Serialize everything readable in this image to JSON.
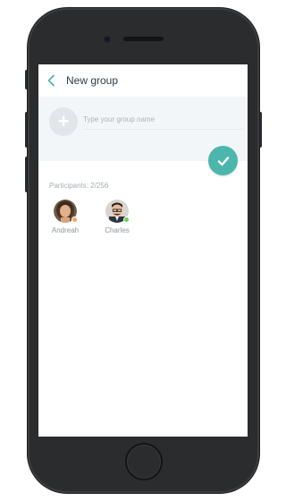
{
  "header": {
    "title": "New group"
  },
  "group_form": {
    "name_placeholder": "Type your group name"
  },
  "participants": {
    "label": "Participants: 2/256",
    "items": [
      {
        "name": "Andreah",
        "status_color": "#f4a261"
      },
      {
        "name": "Charles",
        "status_color": "#6ccf5a"
      }
    ]
  },
  "colors": {
    "accent": "#4db6ac",
    "panel_background": "#f3f6f9",
    "device_frame": "#2b2c2e"
  },
  "icons": {
    "back": "chevron-left-icon",
    "add_photo": "plus-icon",
    "confirm": "check-icon"
  }
}
